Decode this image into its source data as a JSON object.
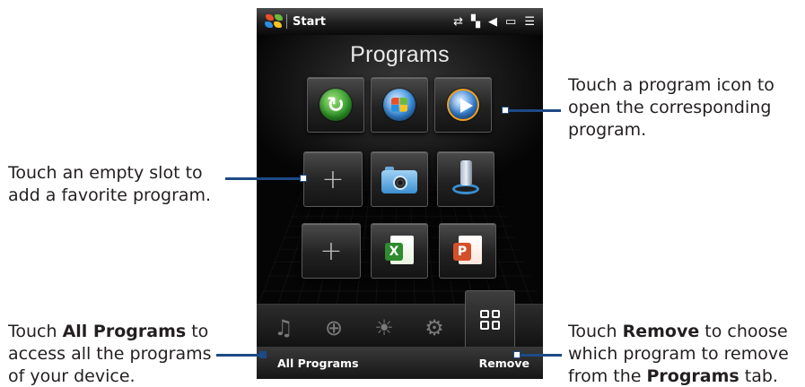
{
  "status_bar": {
    "start_label": "Start",
    "icons": [
      "sync-icon",
      "signal-icon",
      "volume-icon",
      "battery-icon",
      "menu-icon"
    ]
  },
  "screen": {
    "title": "Programs",
    "tiles": [
      {
        "name": "activesync-tile",
        "icon": "sync-icon"
      },
      {
        "name": "windows-tile",
        "icon": "windows-icon"
      },
      {
        "name": "media-player-tile",
        "icon": "media-player-icon"
      },
      {
        "name": "empty-slot-1",
        "icon": "plus-icon",
        "label": "+"
      },
      {
        "name": "camera-tile",
        "icon": "camera-icon"
      },
      {
        "name": "phone-tile",
        "icon": "phone-icon"
      },
      {
        "name": "empty-slot-2",
        "icon": "plus-icon",
        "label": "+"
      },
      {
        "name": "excel-tile",
        "icon": "excel-icon"
      },
      {
        "name": "powerpoint-tile",
        "icon": "powerpoint-icon"
      }
    ]
  },
  "tabs": [
    "music-icon",
    "internet-icon",
    "weather-icon",
    "settings-icon",
    "programs-grid-icon"
  ],
  "softkeys": {
    "left": "All Programs",
    "right": "Remove"
  },
  "callouts": {
    "empty_slot": [
      "Touch an empty slot to",
      "add a favorite program."
    ],
    "program_icon": [
      "Touch a program icon to",
      "open the corresponding",
      "program."
    ],
    "all_programs": {
      "prefix": "Touch ",
      "bold": "All Programs",
      "suffix": " to",
      "line2": "access all the programs",
      "line3": "of your device."
    },
    "remove": {
      "prefix": "Touch ",
      "bold": "Remove",
      "suffix": " to choose",
      "line2": "which program to remove",
      "line3_prefix": "from the ",
      "line3_bold": "Programs",
      "line3_suffix": " tab."
    }
  },
  "colors": {
    "leader_line": "#1d4a86"
  }
}
